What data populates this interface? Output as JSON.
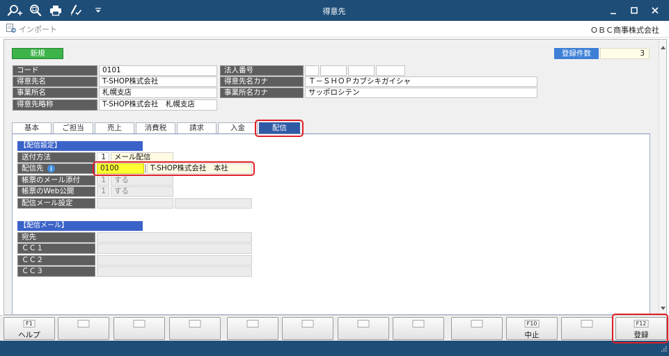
{
  "window": {
    "title": "得意先",
    "quick_access_icons": [
      "search-plus-icon",
      "preview-icon",
      "printer-icon",
      "pen-settings-icon",
      "chevron-down-icon"
    ],
    "control_icons": [
      "minimize-icon",
      "maximize-icon",
      "close-icon"
    ]
  },
  "toolbar": {
    "import_icon": "import-icon",
    "import_label": "インポート",
    "company_name": "ＯＢＣ商事株式会社"
  },
  "status": {
    "mode_label": "新規",
    "count_label": "登録件数",
    "count_value": "3"
  },
  "customer": {
    "code": {
      "label": "コード",
      "value": "0101"
    },
    "corporate_number": {
      "label": "法人番号",
      "cells": [
        "",
        "",
        "",
        ""
      ]
    },
    "name": {
      "label": "得意先名",
      "value": "T-SHOP株式会社"
    },
    "name_kana": {
      "label": "得意先名カナ",
      "value": "Ｔ－ＳＨＯＰカブシキガイシャ"
    },
    "office": {
      "label": "事業所名",
      "value": "札幌支店"
    },
    "office_kana": {
      "label": "事業所名カナ",
      "value": "サッポロシテン"
    },
    "short_name": {
      "label": "得意先略称",
      "value": "T-SHOP株式会社　札幌支店"
    }
  },
  "tabs": [
    {
      "label": "基本",
      "selected": false
    },
    {
      "label": "ご担当",
      "selected": false
    },
    {
      "label": "売上",
      "selected": false
    },
    {
      "label": "消費税",
      "selected": false
    },
    {
      "label": "請求",
      "selected": false
    },
    {
      "label": "入金",
      "selected": false
    },
    {
      "label": "配信",
      "selected": true
    }
  ],
  "delivery_settings": {
    "title": "【配信設定】",
    "send_method": {
      "label": "送付方法",
      "code": "1",
      "value": "メール配信"
    },
    "destination": {
      "label": "配信先",
      "info_icon": "info-icon",
      "code": "0100",
      "value": "T-SHOP株式会社　本社"
    },
    "mail_attachment": {
      "label": "帳票のメール添付",
      "code": "1",
      "value": "する"
    },
    "web_publish": {
      "label": "帳票のWeb公開",
      "code": "1",
      "value": "する"
    },
    "mail_setting": {
      "label": "配信メール設定",
      "value1": "",
      "value2": ""
    }
  },
  "delivery_mail": {
    "title": "【配信メール】",
    "rows": [
      {
        "label": "宛先",
        "value": ""
      },
      {
        "label": "ＣＣ１",
        "value": ""
      },
      {
        "label": "ＣＣ２",
        "value": ""
      },
      {
        "label": "ＣＣ３",
        "value": ""
      }
    ]
  },
  "function_keys": [
    {
      "key": "F1",
      "label": "ヘルプ"
    },
    {
      "key": "",
      "label": ""
    },
    {
      "key": "",
      "label": ""
    },
    {
      "key": "",
      "label": ""
    },
    {
      "key": "",
      "label": ""
    },
    {
      "key": "",
      "label": ""
    },
    {
      "key": "",
      "label": ""
    },
    {
      "key": "",
      "label": ""
    },
    {
      "key": "",
      "label": ""
    },
    {
      "key": "F10",
      "label": "中止"
    },
    {
      "key": "",
      "label": ""
    },
    {
      "key": "F12",
      "label": "登録"
    }
  ],
  "colors": {
    "title_bar": "#1e4d78",
    "mode_badge": "#3db34a",
    "count_label": "#3d7fd6",
    "label_cell": "#5e5e5e",
    "selected_tab": "#2f5aa6",
    "section_header": "#3a62c8",
    "highlight_outline": "#e01e26",
    "destination_code": "#ffff33",
    "readonly_cell": "#ececec",
    "name_cell": "#fffbe3"
  }
}
